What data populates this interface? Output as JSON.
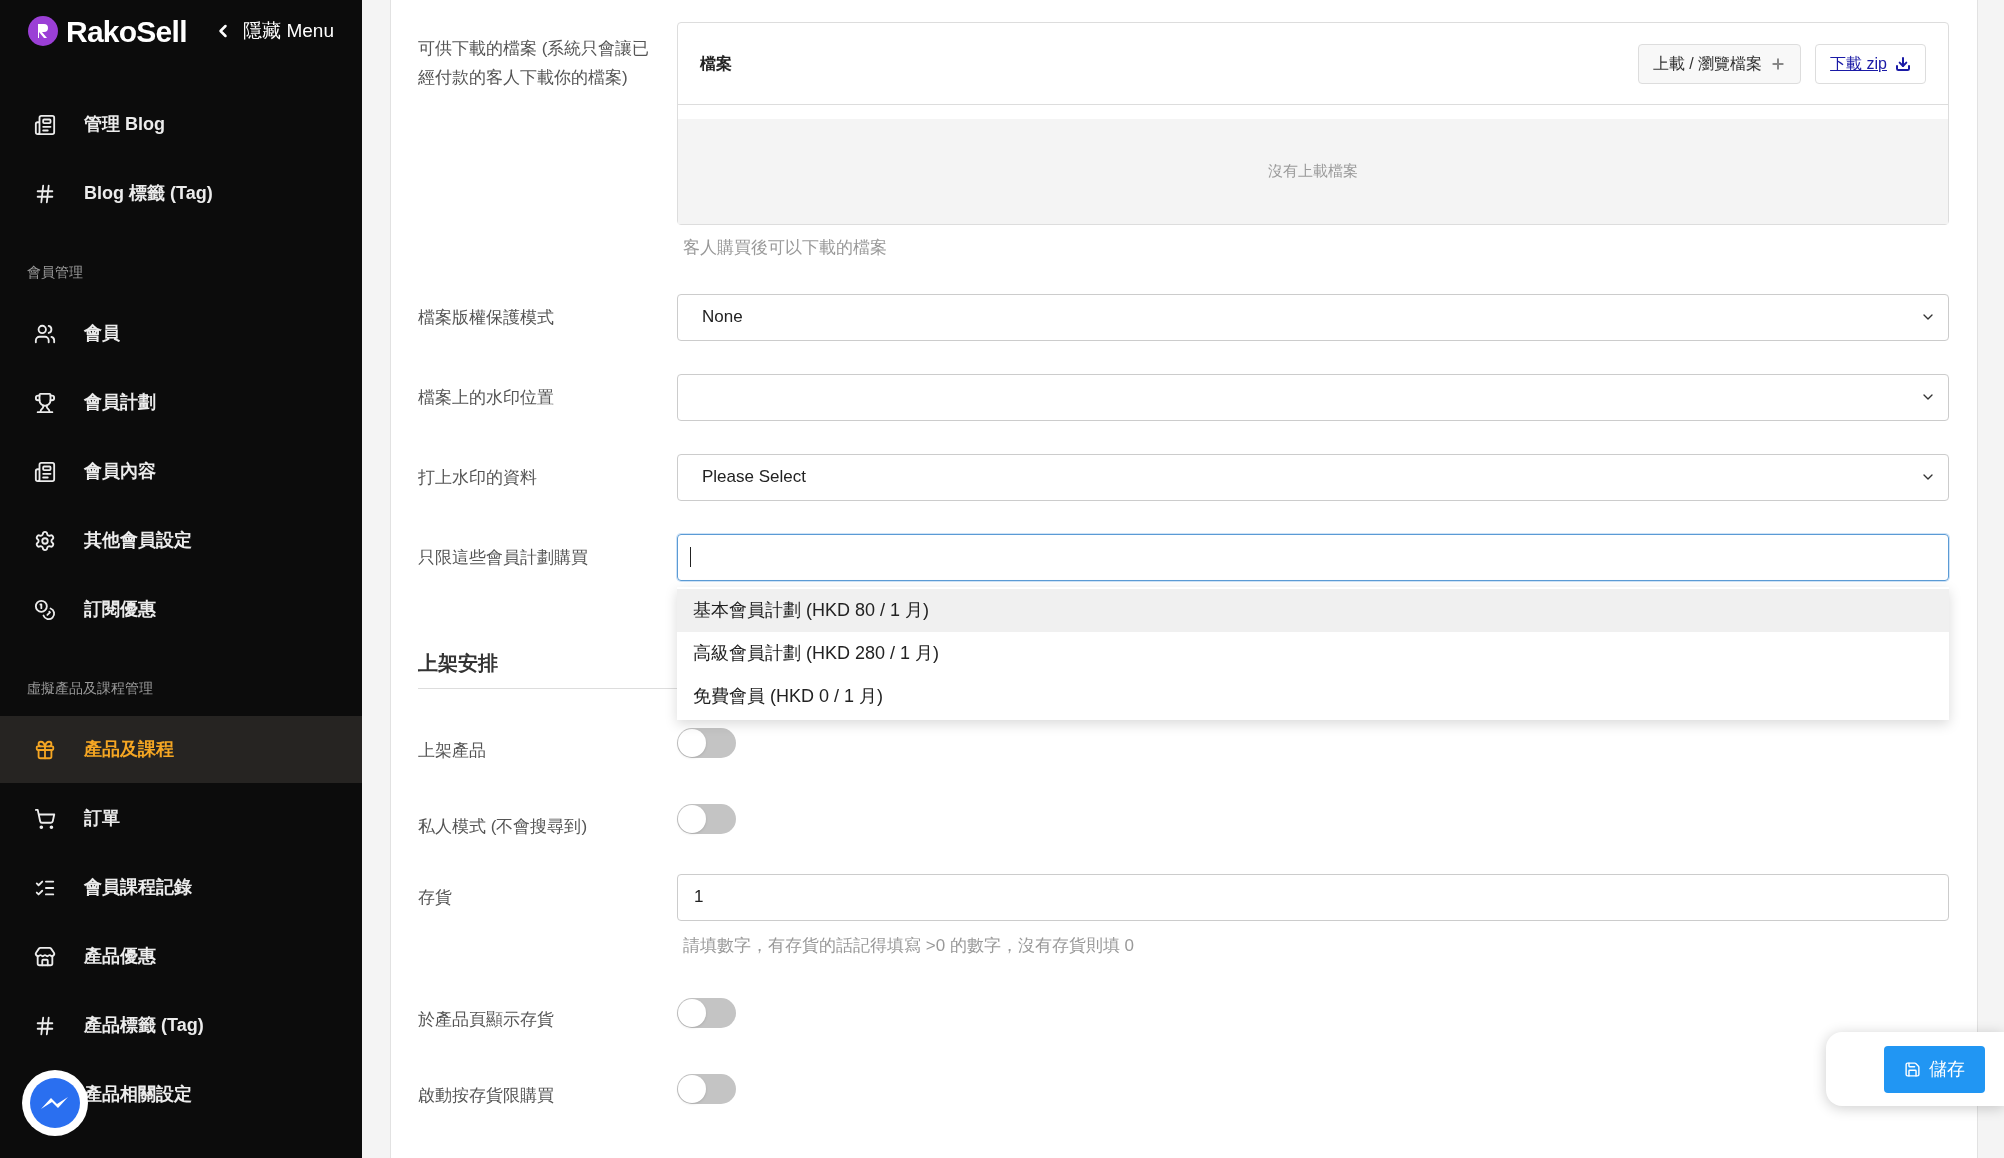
{
  "sidebar": {
    "brand": "RakoSell",
    "hide_menu": "隱藏 Menu",
    "entries": [
      {
        "kind": "item",
        "label": "管理 Blog",
        "selected": false
      },
      {
        "kind": "item",
        "label": "Blog 標籤 (Tag)",
        "selected": false
      },
      {
        "kind": "heading",
        "label": "會員管理"
      },
      {
        "kind": "item",
        "label": "會員",
        "selected": false
      },
      {
        "kind": "item",
        "label": "會員計劃",
        "selected": false
      },
      {
        "kind": "item",
        "label": "會員內容",
        "selected": false
      },
      {
        "kind": "item",
        "label": "其他會員設定",
        "selected": false
      },
      {
        "kind": "item",
        "label": "訂閱優惠",
        "selected": false
      },
      {
        "kind": "heading",
        "label": "虛擬產品及課程管理"
      },
      {
        "kind": "item",
        "label": "產品及課程",
        "selected": true
      },
      {
        "kind": "item",
        "label": "訂單",
        "selected": false
      },
      {
        "kind": "item",
        "label": "會員課程記錄",
        "selected": false
      },
      {
        "kind": "item",
        "label": "產品優惠",
        "selected": false
      },
      {
        "kind": "item",
        "label": "產品標籤 (Tag)",
        "selected": false
      },
      {
        "kind": "item",
        "label": "產品相關設定",
        "selected": false
      }
    ]
  },
  "form": [
    {
      "kind": "files",
      "label": "可供下載的檔案 (系統只會讓已經付款的客人下載你的檔案)",
      "title": "檔案",
      "upload": "上載 / 瀏覽檔案",
      "download": "下載 zip",
      "empty": "沒有上載檔案",
      "hint": "客人購買後可以下載的檔案"
    },
    {
      "kind": "select",
      "label": "檔案版權保護模式",
      "value": "None"
    },
    {
      "kind": "select",
      "label": "檔案上的水印位置"
    },
    {
      "kind": "select",
      "label": "打上水印的資料",
      "value": "Please Select"
    },
    {
      "kind": "input",
      "label": "只限這些會員計劃購買",
      "focused": true,
      "options": [
        {
          "label": "基本會員計劃 (HKD 80 / 1 月)",
          "selected": true
        },
        {
          "label": "高級會員計劃 (HKD 280 / 1 月)",
          "selected": false
        },
        {
          "label": "免費會員 (HKD 0 / 1 月)",
          "selected": false
        }
      ]
    },
    {
      "kind": "heading",
      "label": "上架安排"
    },
    {
      "kind": "toggle",
      "label": "上架產品",
      "on": false
    },
    {
      "kind": "toggle",
      "label": "私人模式 (不會搜尋到)",
      "on": false
    },
    {
      "kind": "input",
      "label": "存貨",
      "value": "1",
      "focused": false,
      "hint": "請填數字，有存貨的話記得填寫 >0 的數字，沒有存貨則填 0"
    },
    {
      "kind": "toggle",
      "label": "於產品頁顯示存貨",
      "on": false
    },
    {
      "kind": "toggle",
      "label": "啟動按存貨限購買",
      "on": false
    }
  ],
  "save_button": "儲存"
}
